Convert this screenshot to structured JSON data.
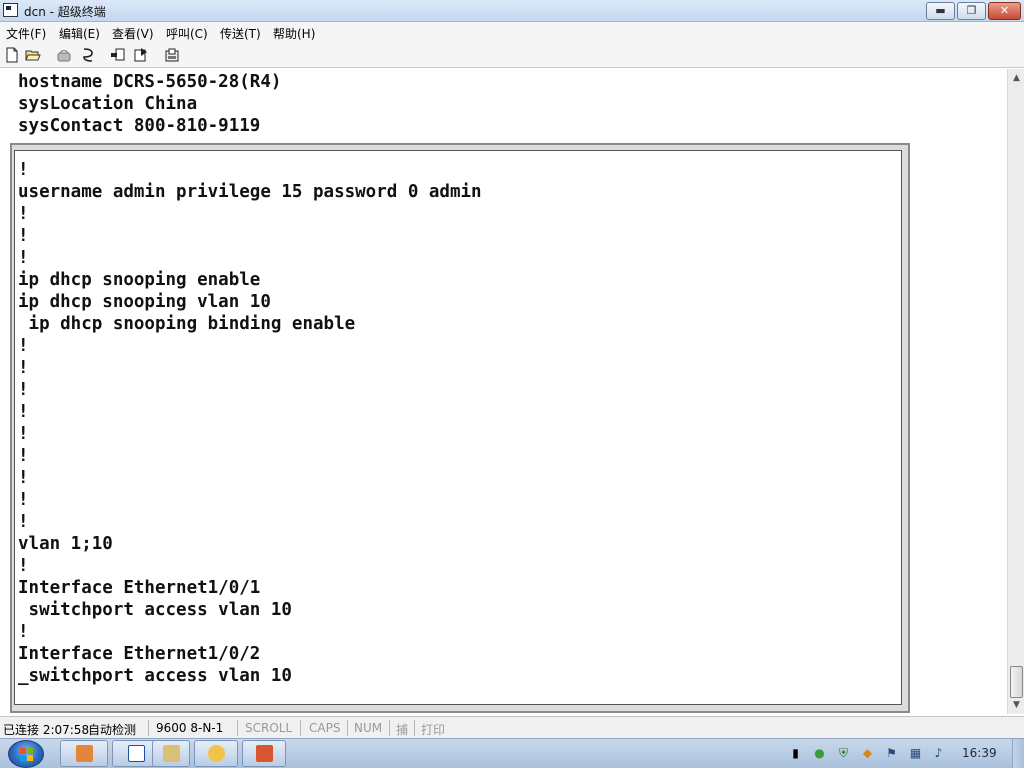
{
  "window": {
    "title": "dcn - 超级终端",
    "min_label": "▬",
    "max_label": "❐",
    "close_label": "✕"
  },
  "menu": [
    "文件(F)",
    "编辑(E)",
    "查看(V)",
    "呼叫(C)",
    "传送(T)",
    "帮助(H)"
  ],
  "toolbar": {
    "icons": [
      "new-icon",
      "open-icon",
      "disconnect-icon",
      "properties-icon",
      "send-file-icon",
      "receive-file-icon",
      "settings-icon"
    ]
  },
  "terminal": {
    "header_lines": [
      "hostname DCRS-5650-28(R4)",
      "sysLocation China",
      "sysContact 800-810-9119"
    ],
    "lines": [
      "!",
      "username admin privilege 15 password 0 admin",
      "!",
      "!",
      "!",
      "ip dhcp snooping enable",
      "ip dhcp snooping vlan 10",
      " ip dhcp snooping binding enable",
      "!",
      "!",
      "!",
      "!",
      "!",
      "!",
      "!",
      "!",
      "!",
      "vlan 1;10",
      "!",
      "Interface Ethernet1/0/1",
      " switchport access vlan 10",
      "!",
      "Interface Ethernet1/0/2",
      "_switchport access vlan 10"
    ]
  },
  "statusbar": {
    "connection": "已连接 2:07:58",
    "detect": "自动检测",
    "port_settings": "9600 8-N-1",
    "scroll": "SCROLL",
    "caps": "CAPS",
    "num": "NUM",
    "capture": "捕",
    "print": "打印"
  },
  "taskbar": {
    "clock": "16:39"
  }
}
